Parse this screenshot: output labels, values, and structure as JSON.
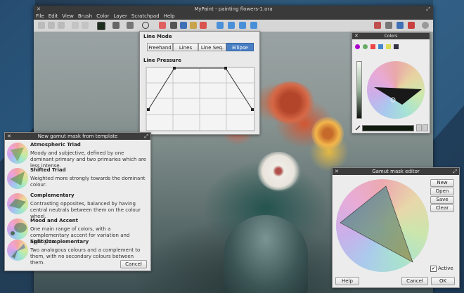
{
  "app": {
    "title": "MyPaint - painting flowers-1.ora",
    "menu": [
      "File",
      "Edit",
      "View",
      "Brush",
      "Color",
      "Layer",
      "Scratchpad",
      "Help"
    ]
  },
  "toolbar": {
    "icons": [
      "new-icon",
      "open-icon",
      "save-icon",
      "undo-icon",
      "redo-icon",
      "color-swatch-icon",
      "brush-icon",
      "symmetry-icon",
      "ellipse-tool-icon",
      "eraser-icon",
      "picker-icon",
      "fill-icon",
      "stamp-icon",
      "text-icon",
      "move-icon",
      "zoom-icon",
      "rotate-icon",
      "flip-icon",
      "layers-icon",
      "brush-settings-icon",
      "color-panel-icon",
      "scratchpad-icon",
      "settings-icon"
    ]
  },
  "line_mode_panel": {
    "title": "Line Mode",
    "modes": [
      "Freehand",
      "Lines",
      "Line Seq.",
      "Ellipse"
    ],
    "active_mode": "Ellipse",
    "pressure_title": "Line Pressure"
  },
  "colors_panel": {
    "title": "Colors"
  },
  "gamut_template_dialog": {
    "title": "New gamut mask from template",
    "templates": [
      {
        "name": "Atmospheric Triad",
        "desc": "Moody and subjective, defined by one dominant primary and two primaries which are less intense."
      },
      {
        "name": "Shifted Triad",
        "desc": "Weighted more strongly towards the dominant colour."
      },
      {
        "name": "Complementary",
        "desc": "Contrasting opposites, balanced by having central neutrals between them on the colour wheel."
      },
      {
        "name": "Mood and Accent",
        "desc": "One main range of colors, with a complementary accent for variation and highlights."
      },
      {
        "name": "Split Complementary",
        "desc": "Two analogous colours and a complement to them, with no secondary colours between them."
      }
    ],
    "cancel": "Cancel"
  },
  "gamut_editor": {
    "title": "Gamut mask editor",
    "buttons": {
      "new": "New",
      "open": "Open",
      "save": "Save",
      "clear": "Clear"
    },
    "active_label": "Active",
    "active_checked": true,
    "help": "Help",
    "cancel": "Cancel",
    "ok": "OK"
  }
}
